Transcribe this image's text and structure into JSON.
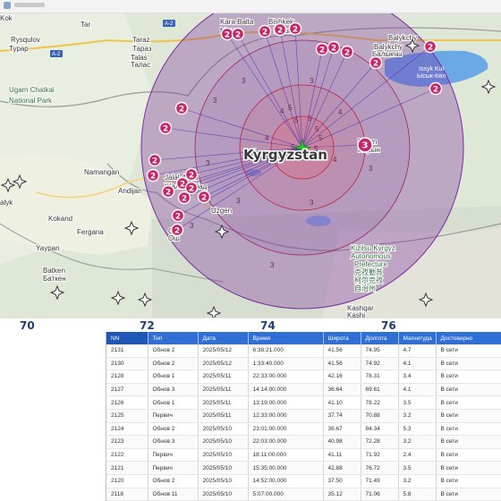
{
  "map": {
    "country_label": "Kyrgyzstan",
    "place_labels": [
      {
        "text": "Tar",
        "cls": "d"
      },
      {
        "text": "Rysqulov",
        "cls": "d"
      },
      {
        "text": "Турар",
        "cls": "d"
      },
      {
        "text": "Taraz",
        "cls": "d"
      },
      {
        "text": "Тараз",
        "cls": "d"
      },
      {
        "text": "Talas",
        "cls": "d"
      },
      {
        "text": "Талас",
        "cls": "d"
      },
      {
        "text": "Ugam Chatkal",
        "cls": "g"
      },
      {
        "text": "National Park",
        "cls": "g"
      },
      {
        "text": "Bishkek",
        "cls": "d"
      },
      {
        "text": "Бишкек",
        "cls": "d"
      },
      {
        "text": "Kara Balta",
        "cls": "d"
      },
      {
        "text": "Мерки",
        "cls": "d"
      },
      {
        "text": "Balykchy",
        "cls": "d"
      },
      {
        "text": "Балыкчы",
        "cls": "d"
      },
      {
        "text": "Issyk Kul",
        "cls": "w"
      },
      {
        "text": "Ысык-Көл",
        "cls": "w"
      },
      {
        "text": "Naryn",
        "cls": "d"
      },
      {
        "text": "Нарын",
        "cls": "d"
      },
      {
        "text": "Namangan",
        "cls": "d"
      },
      {
        "text": "Andijan",
        "cls": "d"
      },
      {
        "text": "Jalal-Abad",
        "cls": "d"
      },
      {
        "text": "Жалал-Абад",
        "cls": "d"
      },
      {
        "text": "Kokand",
        "cls": "d"
      },
      {
        "text": "Fergana",
        "cls": "d"
      },
      {
        "text": "Yaypan",
        "cls": "d"
      },
      {
        "text": "Osh",
        "cls": "d"
      },
      {
        "text": "Ош",
        "cls": "d"
      },
      {
        "text": "Uzgen",
        "cls": "d"
      },
      {
        "text": "Batken",
        "cls": "d"
      },
      {
        "text": "Баткен",
        "cls": "d"
      },
      {
        "text": "Kizilsu Kyrgyz",
        "cls": "g"
      },
      {
        "text": "Autonomous",
        "cls": "g"
      },
      {
        "text": "Prefecture",
        "cls": "g"
      },
      {
        "text": "克孜勒苏",
        "cls": "g"
      },
      {
        "text": "柯尔克孜",
        "cls": "g"
      },
      {
        "text": "自治州",
        "cls": "g"
      },
      {
        "text": "Kashgar",
        "cls": "d"
      },
      {
        "text": "Kashi",
        "cls": "d"
      },
      {
        "text": "Balykchy",
        "cls": "d"
      },
      {
        "text": "alyk",
        "cls": "d"
      },
      {
        "text": "Kok",
        "cls": "d"
      },
      {
        "text": "A-2",
        "cls": "r"
      },
      {
        "text": "A-2",
        "cls": "r"
      }
    ],
    "markers": [
      "2",
      "2",
      "2",
      "2",
      "2",
      "2",
      "2",
      "2",
      "2",
      "2",
      "2",
      "2",
      "2",
      "2",
      "2",
      "2",
      "2",
      "2",
      "2",
      "2",
      "2",
      "2",
      "2",
      "3"
    ],
    "inner_numbers": [
      "3",
      "3",
      "3",
      "3",
      "3",
      "3",
      "3",
      "4",
      "4",
      "4",
      "5",
      "5",
      "5",
      "5",
      "5",
      "5",
      "5",
      "3",
      "3",
      "4",
      "4"
    ],
    "colors": {
      "marker_fill": "#cc2266",
      "ring_fill": "#7a2da0",
      "epicenter": "#22c822",
      "water": "#6aa8e8"
    }
  },
  "axis": {
    "labels": [
      "70",
      "72",
      "74",
      "76"
    ]
  },
  "table": {
    "columns": [
      "NN",
      "Тип",
      "Дата",
      "Время",
      "Широта",
      "Долгота",
      "Магнитуда",
      "Достоверно"
    ],
    "rows": [
      [
        "2131",
        "Обнов 2",
        "2025/05/12",
        "6:38:21.000",
        "41.56",
        "74.95",
        "4.7",
        "В сети"
      ],
      [
        "2130",
        "Обнов 2",
        "2025/05/12",
        "1:33:40.000",
        "41.56",
        "74.92",
        "4.1",
        "В сети"
      ],
      [
        "2128",
        "Обнов 1",
        "2025/05/11",
        "22:33:00.000",
        "42.16",
        "78.31",
        "3.4",
        "В сети"
      ],
      [
        "2127",
        "Обнов 3",
        "2025/05/11",
        "14:14:00.000",
        "36.64",
        "69.61",
        "4.1",
        "В сети"
      ],
      [
        "2126",
        "Обнов 1",
        "2025/05/11",
        "13:19:00.000",
        "41.10",
        "78.22",
        "3.5",
        "В сети"
      ],
      [
        "2125",
        "Первич",
        "2025/05/11",
        "12:33:00.000",
        "37.74",
        "70.88",
        "3.2",
        "В сети"
      ],
      [
        "2124",
        "Обнов 2",
        "2025/05/10",
        "23:01:00.000",
        "36.67",
        "84.34",
        "5.3",
        "В сети"
      ],
      [
        "2123",
        "Обнов 3",
        "2025/05/10",
        "22:03:00.000",
        "40.98",
        "72.28",
        "3.2",
        "В сети"
      ],
      [
        "2122",
        "Первич",
        "2025/05/10",
        "18:11:00.000",
        "41.11",
        "71.92",
        "2.4",
        "В сети"
      ],
      [
        "2121",
        "Первич",
        "2025/05/10",
        "15:35:00.000",
        "42.88",
        "76.72",
        "3.5",
        "В сети"
      ],
      [
        "2120",
        "Обнов 2",
        "2025/05/10",
        "14:52:00.000",
        "37.50",
        "71.49",
        "3.2",
        "В сети"
      ],
      [
        "2118",
        "Обнов 11",
        "2025/05/10",
        "5:07:00.000",
        "35.12",
        "71.06",
        "5.8",
        "В сети"
      ]
    ]
  }
}
